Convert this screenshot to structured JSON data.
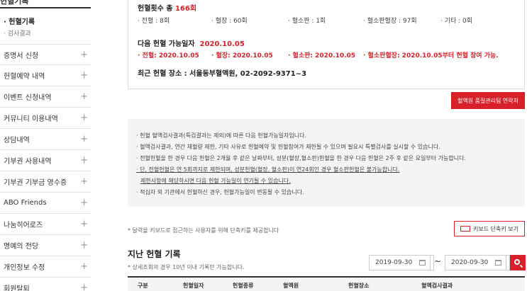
{
  "sidebar": {
    "header": "헌혈기록",
    "active_sub": "· 헌혈기록",
    "sub_item": "· 검사결과",
    "items": [
      {
        "label": "증명서 신청"
      },
      {
        "label": "헌혈예약 내역"
      },
      {
        "label": "이벤트 신청내역"
      },
      {
        "label": "커뮤니티 이용내역"
      },
      {
        "label": "상담내역"
      },
      {
        "label": "기부권 사용내역"
      },
      {
        "label": "기부권 기부금 영수증"
      },
      {
        "label": "ABO Friends"
      },
      {
        "label": "나눔히어로즈"
      },
      {
        "label": "명예의 전당"
      },
      {
        "label": "개인정보 수정"
      },
      {
        "label": "회원탈퇴"
      }
    ],
    "plus": "+"
  },
  "summary": {
    "total_prefix": "헌혈횟수 총 ",
    "total_value": "166회",
    "stats": [
      "· 전혈 : 8회",
      "· 혈장 : 60회",
      "· 혈소판 : 1회",
      "· 혈소판혈장 : 97회",
      "· 기타 : 0회"
    ],
    "next_prefix": "다음 헌혈 가능일자",
    "next_date": "2020.10.05",
    "next_items": [
      "· 전혈: 2020.10.05",
      "· 혈장: 2020.10.05",
      "· 혈소판: 2020.10.05",
      "· 혈소판혈장: 2020.10.05부터 헌혈 참여 가능."
    ],
    "recent": "최근 헌혈 장소 : 서울동부혈액원, 02-2092-9371~3"
  },
  "quality_button": "혈액원 품질관리팀 연락처",
  "notices": [
    "· 헌혈 혈액검사결과(특검결과는 제외)에 따른 다음 헌혈가능일자입니다.",
    "· 혈액검사결과, 연간 채혈량 제한, 기타 사유로 헌혈예약 및 헌혈참여가 제한될 수 있으며 필요시 특별검사를 실시할 수 있습니다.",
    "· 전혈헌혈을 한 경우 다음 헌혈은 2개월 후 같은 날짜부터, 성분(혈장,혈소판)헌혈을 한 경우 다음 헌혈은 2주 후 같은 요일부터 가능합니다.",
    "· 단, 전혈헌혈은 연 5회까지로 제한되며, 성분헌혈(혈장, 혈소판)이 연24회인 경우 혈소판헌혈은 불가능합니다.",
    "  제한사항에 해당하시면 다음 헌혈 가능일이 연기될 수 있습니다.",
    "· 적십자 외 기관에서 헌혈하신 경우, 헌혈가능일이 변동될 수 있습니다."
  ],
  "keyboard_note": "* 달력을 키보드로 접근하는 사용자를 위해 단축키를 제공합니다",
  "keyboard_button": "키보드 단축키 보기",
  "history": {
    "title": "지난 헌혈 기록",
    "note": "* 상세조회의 경우 10년 이내 기록만 가능합니다.",
    "date_from": "2019-09-30",
    "date_to": "2020-09-30",
    "tilde": "~",
    "columns": [
      "구분",
      "헌혈일자",
      "헌혈종류",
      "혈액원",
      "헌혈장소",
      "혈액검사결과"
    ]
  }
}
